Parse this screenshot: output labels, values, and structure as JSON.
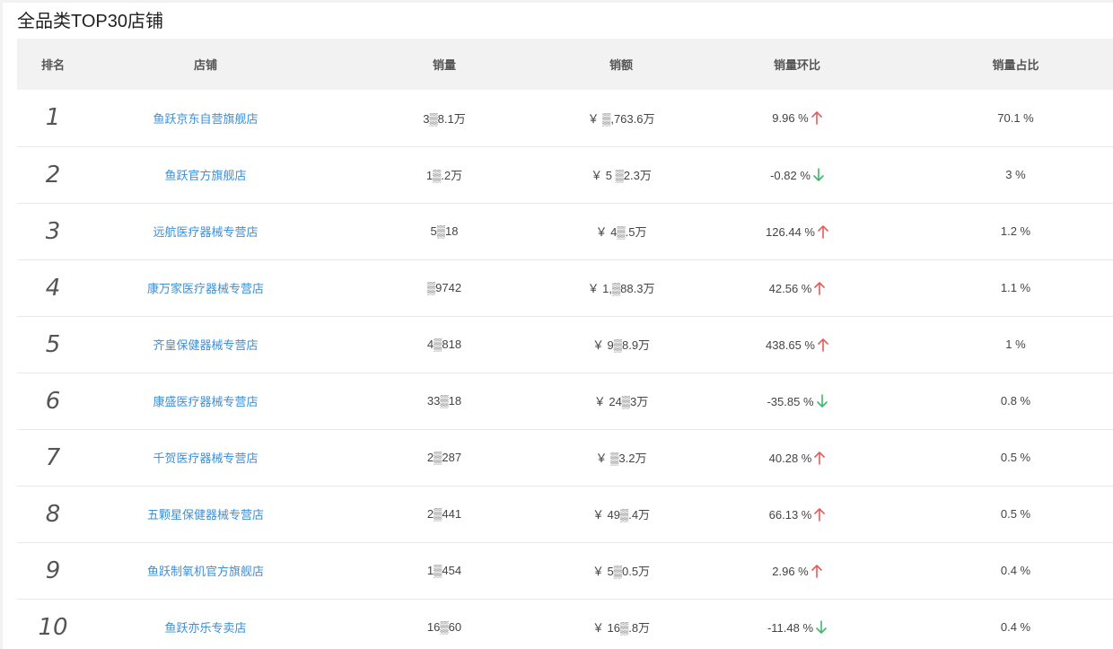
{
  "title": "全品类TOP30店铺",
  "colors": {
    "up": "#e85a5a",
    "down": "#3cba6a",
    "link": "#3d8fd8",
    "header_bg": "#f2f2f2"
  },
  "headers": {
    "rank": "排名",
    "shop": "店铺",
    "qty": "销量",
    "amount": "销额",
    "mom": "销量环比",
    "share": "销量占比"
  },
  "rows": [
    {
      "rank": "1",
      "shop": "鱼跃京东自营旗舰店",
      "qty": "3▒8.1万",
      "amount": "￥ ▒,763.6万",
      "mom": "9.96 %",
      "trend": "up",
      "trend_icon": "arrow-up-icon",
      "share": "70.1 %"
    },
    {
      "rank": "2",
      "shop": "鱼跃官方旗舰店",
      "qty": "1▒.2万",
      "amount": "￥ 5 ▒2.3万",
      "mom": "-0.82 %",
      "trend": "down",
      "trend_icon": "arrow-down-icon",
      "share": "3 %"
    },
    {
      "rank": "3",
      "shop": "远航医疗器械专营店",
      "qty": "5▒18",
      "amount": "￥ 4▒.5万",
      "mom": "126.44 %",
      "trend": "up",
      "trend_icon": "arrow-up-icon",
      "share": "1.2 %"
    },
    {
      "rank": "4",
      "shop": "康万家医疗器械专营店",
      "qty": "▒9742",
      "amount": "￥ 1,▒88.3万",
      "mom": "42.56 %",
      "trend": "up",
      "trend_icon": "arrow-up-icon",
      "share": "1.1 %"
    },
    {
      "rank": "5",
      "shop": "齐皇保健器械专营店",
      "qty": "4▒818",
      "amount": "￥ 9▒8.9万",
      "mom": "438.65 %",
      "trend": "up",
      "trend_icon": "arrow-up-icon",
      "share": "1 %"
    },
    {
      "rank": "6",
      "shop": "康盛医疗器械专营店",
      "qty": "33▒18",
      "amount": "￥ 24▒3万",
      "mom": "-35.85 %",
      "trend": "down",
      "trend_icon": "arrow-down-icon",
      "share": "0.8 %"
    },
    {
      "rank": "7",
      "shop": "千贺医疗器械专营店",
      "qty": "2▒287",
      "amount": "￥ ▒3.2万",
      "mom": "40.28 %",
      "trend": "up",
      "trend_icon": "arrow-up-icon",
      "share": "0.5 %"
    },
    {
      "rank": "8",
      "shop": "五颗星保健器械专营店",
      "qty": "2▒441",
      "amount": "￥ 49▒.4万",
      "mom": "66.13 %",
      "trend": "up",
      "trend_icon": "arrow-up-icon",
      "share": "0.5 %"
    },
    {
      "rank": "9",
      "shop": "鱼跃制氧机官方旗舰店",
      "qty": "1▒454",
      "amount": "￥ 5▒0.5万",
      "mom": "2.96 %",
      "trend": "up",
      "trend_icon": "arrow-up-icon",
      "share": "0.4 %"
    },
    {
      "rank": "10",
      "shop": "鱼跃亦乐专卖店",
      "qty": "16▒60",
      "amount": "￥ 16▒.8万",
      "mom": "-11.48 %",
      "trend": "down",
      "trend_icon": "arrow-down-icon",
      "share": "0.4 %"
    }
  ]
}
